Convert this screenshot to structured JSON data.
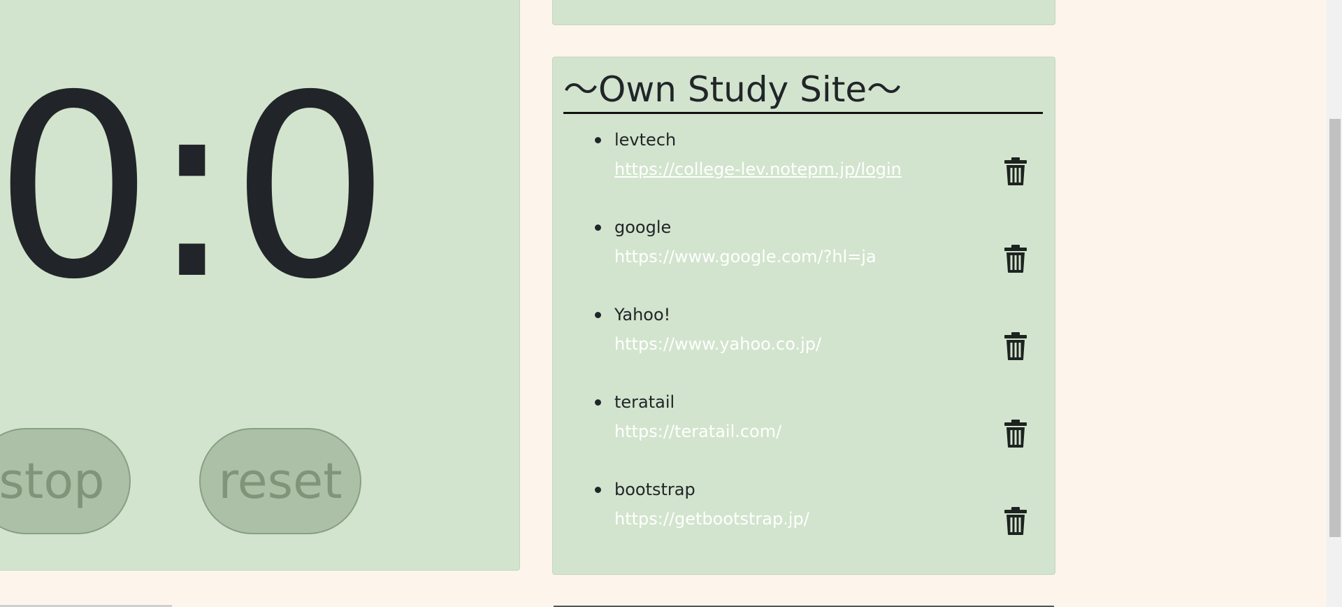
{
  "timer": {
    "display": "0:0",
    "stop_label": "stop",
    "reset_label": "reset"
  },
  "study_sites": {
    "title": "～Own Study Site～",
    "items": [
      {
        "name": "levtech",
        "url": "https://college-lev.notepm.jp/login",
        "visited": true
      },
      {
        "name": "google",
        "url": "https://www.google.com/?hl=ja",
        "visited": false
      },
      {
        "name": "Yahoo!",
        "url": "https://www.yahoo.co.jp/",
        "visited": false
      },
      {
        "name": "teratail",
        "url": "https://teratail.com/",
        "visited": false
      },
      {
        "name": "bootstrap",
        "url": "https://getbootstrap.jp/",
        "visited": false
      }
    ],
    "delete_icon": "trash-icon"
  },
  "colors": {
    "page_background": "#fdf4ec",
    "card_background": "#d2e4cd",
    "button_background": "#acc0a7",
    "button_text": "#7f957a",
    "text": "#212529",
    "link": "#ffffff"
  }
}
